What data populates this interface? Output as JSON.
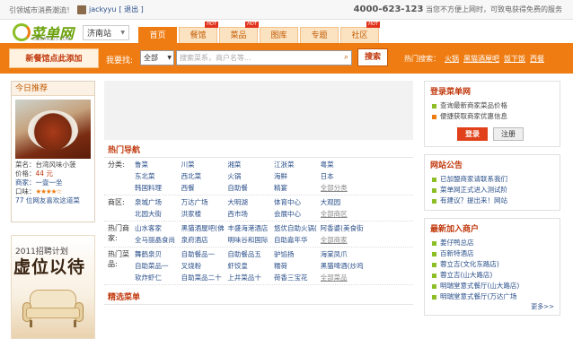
{
  "topbar": {
    "left_text": "引领城市消费潮流！",
    "user": "jackyyu",
    "logout": "[ 退出 ]",
    "phone": "4000-623-123",
    "phone_note": "当您不方便上网时，可致电获得免费的服务"
  },
  "header": {
    "logo_cn": "菜单网",
    "logo_en": "CAIDAN123.COM",
    "city": "济南站",
    "tabs": [
      {
        "label": "首页",
        "hot": ""
      },
      {
        "label": "餐馆",
        "hot": "HOT"
      },
      {
        "label": "菜品",
        "hot": "HOT"
      },
      {
        "label": "图库",
        "hot": ""
      },
      {
        "label": "专题",
        "hot": ""
      },
      {
        "label": "社区",
        "hot": "HOT"
      }
    ]
  },
  "searchbar": {
    "add_button": "新餐馆点此添加",
    "label": "我要找:",
    "select_value": "全部",
    "placeholder": "搜索菜系，商户名等...",
    "search_button": "搜索",
    "hot_label": "热门搜索：",
    "hot_keywords": [
      "火锅",
      "黑猫酒屋吧",
      "饭下饭",
      "西餐"
    ]
  },
  "today": {
    "title": "今日推荐",
    "dish_name": "菜名：台湾风味小菠",
    "price_label": "价格：",
    "price": "44 元",
    "shop": "商家：一壹一坐",
    "rating_label": "口味：",
    "stars": "★★★★☆",
    "likes": "77 位网友喜欢这道菜"
  },
  "ad": {
    "year_plan": "2011招聘计划",
    "slogan": "虚位以待"
  },
  "hotnav": {
    "title": "热门导航",
    "rows": [
      {
        "label": "分类:",
        "items": [
          "鲁菜",
          "川菜",
          "湘菜",
          "江浙菜",
          "粤菜",
          "",
          "东北菜",
          "西北菜",
          "火锅",
          "海鲜",
          "日本",
          "",
          "韩国料理",
          "西餐",
          "自助餐",
          "精宴",
          "全部分类",
          ""
        ]
      },
      {
        "label": "商区:",
        "items": [
          "泉城广场",
          "万达广场",
          "大明湖",
          "体育中心",
          "大观园",
          "",
          "北园大街",
          "洪家楼",
          "西市场",
          "会展中心",
          "全部商区",
          ""
        ]
      },
      {
        "label": "热门商家:",
        "items": [
          "山水客家",
          "黑猫酒屋吧(佛",
          "丰盛海港酒店",
          "悠优自助火锅(",
          "阿香婆(美食街",
          "",
          "全马丽晶食尚",
          "泉府酒店",
          "明味谷和国际",
          "自助嘉年华",
          "全部商家",
          ""
        ]
      },
      {
        "label": "热门菜品:",
        "items": [
          "舞鹤泉贝",
          "自助餐品一",
          "自助餐品五",
          "驴馅扬",
          "海棠凤爪",
          "",
          "自助菜品一",
          "叉烧粉",
          "虾饺皇",
          "糯荷",
          "黑猫啤酒(炒鸡",
          "",
          "软炸虾仁",
          "自助菜品二十",
          "上井菜品十",
          "荷香三宝花",
          "全部菜品",
          ""
        ]
      }
    ],
    "selected_title": "精选菜单"
  },
  "login": {
    "title": "登录菜单网",
    "items": [
      "查询最新商家菜品价格",
      "便捷获取商家优惠信息"
    ],
    "login_btn": "登录",
    "register_btn": "注册"
  },
  "notice": {
    "title": "网站公告",
    "items": [
      "已加盟商家请联系我们",
      "菜单网正式进入测试阶",
      "有建议？提出来！网站"
    ]
  },
  "newshops": {
    "title": "最新加入商户",
    "items": [
      "姜仔鸭总店",
      "百新特酒店",
      "蓉立吉(文化东路店)",
      "蓉立吉(山大路店)",
      "明瑞堂意式餐厅(山大路店)",
      "明瑞堂意式餐厅(万达广场"
    ],
    "more": "更多>>"
  }
}
